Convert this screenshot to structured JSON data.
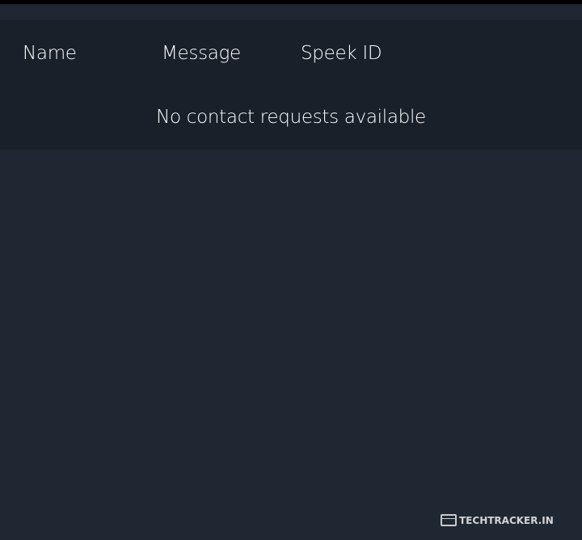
{
  "table": {
    "columns": [
      "Name",
      "Message",
      "Speek ID"
    ],
    "empty_message": "No contact requests available"
  },
  "watermark": {
    "text": "TechTracker.in",
    "icon": "browser-window-icon"
  }
}
